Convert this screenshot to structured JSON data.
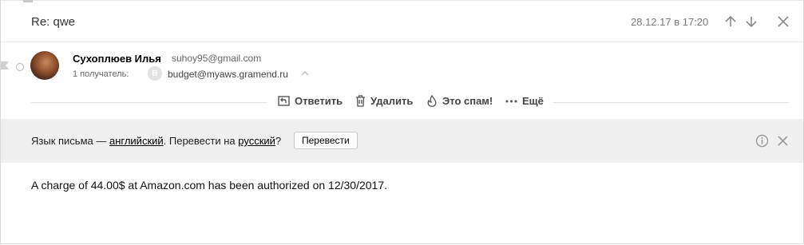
{
  "header": {
    "subject": "Re: qwe",
    "date": "28.12.17 в 17:20"
  },
  "sender": {
    "name": "Сухоплюев Илья",
    "email": "suhoy95@gmail.com",
    "recipients_label": "1 получатель:",
    "recipient_initial": "B",
    "recipient_email": "budget@myaws.gramend.ru"
  },
  "actions": {
    "reply": "Ответить",
    "delete": "Удалить",
    "spam": "Это спам!",
    "more": "Ещё"
  },
  "translate": {
    "prefix": "Язык письма — ",
    "language": "английский",
    "middle": ". Перевести на ",
    "target": "русский",
    "suffix": "?",
    "button": "Перевести"
  },
  "body": {
    "text": "A charge of 44.00$ at Amazon.com has been authorized on 12/30/2017."
  },
  "colors": {
    "translate_bar_bg": "#f0f0f0",
    "icon_gray": "#8a8a8a"
  }
}
